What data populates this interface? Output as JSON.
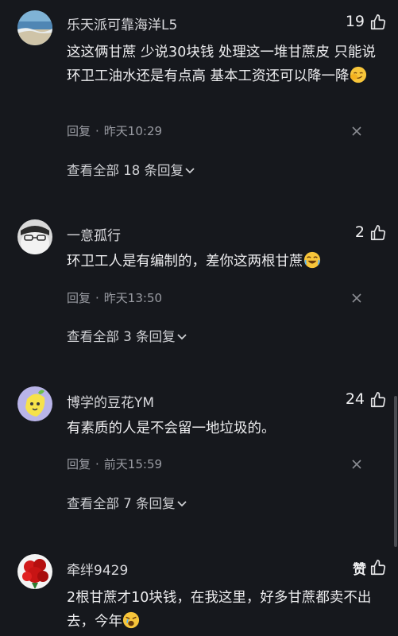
{
  "comments": [
    {
      "username": "乐天派可靠海洋L5",
      "likes": "19",
      "text": "这这俩甘蔗 少说30块钱 处理这一堆甘蔗皮 只能说环卫工油水还是有点高 基本工资还可以降一降",
      "emoji": "smirk-emoji",
      "reply_label": "回复",
      "time": "昨天10:29",
      "view_all": "查看全部 18 条回复"
    },
    {
      "username": "一意孤行",
      "likes": "2",
      "text": "环卫工人是有编制的，差你这两根甘蔗",
      "emoji": "laughing-emoji",
      "reply_label": "回复",
      "time": "昨天13:50",
      "view_all": "查看全部 3 条回复"
    },
    {
      "username": "博学的豆花YM",
      "likes": "24",
      "text": "有素质的人是不会留一地垃圾的。",
      "reply_label": "回复",
      "time": "前天15:59",
      "view_all": "查看全部 7 条回复"
    },
    {
      "username": "牵绊9429",
      "likes": "赞",
      "text": "2根甘蔗才10块钱，在我这里，好多甘蔗都卖不出去，今年",
      "emoji": "weary-emoji"
    }
  ],
  "colors": {
    "background": "#16181d",
    "text": "#ececee",
    "muted": "#9a9ca3"
  }
}
